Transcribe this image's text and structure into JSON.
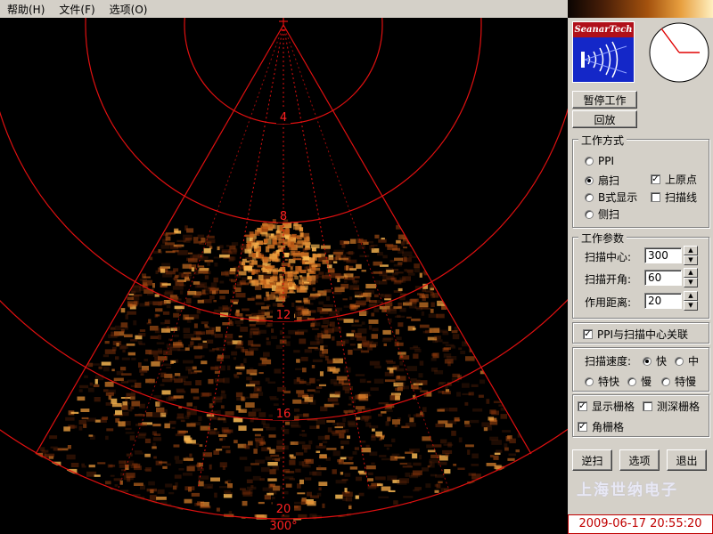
{
  "menu": {
    "items": [
      "帮助(H)",
      "文件(F)",
      "选项(O)"
    ]
  },
  "sonar": {
    "range_labels": [
      "4",
      "8",
      "12",
      "16",
      "20"
    ],
    "bearing_label": "300°",
    "grid_color": "#e01010",
    "echo_color": "#e8901e"
  },
  "logo": {
    "text": "SeanarTech"
  },
  "buttons": {
    "pause": "暂停工作",
    "playback": "回放",
    "reverse_scan": "逆扫",
    "options": "选项",
    "exit": "退出"
  },
  "work_mode": {
    "title": "工作方式",
    "modes": [
      {
        "label": "PPI",
        "selected": false
      },
      {
        "label": "扇扫",
        "selected": true
      },
      {
        "label": "B式显示",
        "selected": false
      },
      {
        "label": "侧扫",
        "selected": false
      }
    ],
    "upper_origin": {
      "label": "上原点",
      "checked": true
    },
    "scan_line": {
      "label": "扫描线",
      "checked": false
    }
  },
  "params": {
    "title": "工作参数",
    "fields": [
      {
        "label": "扫描中心:",
        "value": "300"
      },
      {
        "label": "扫描开角:",
        "value": "60"
      },
      {
        "label": "作用距离:",
        "value": "20"
      }
    ]
  },
  "link": {
    "label": "PPI与扫描中心关联",
    "checked": true
  },
  "speed": {
    "label": "扫描速度:",
    "options": [
      {
        "label": "快",
        "selected": true
      },
      {
        "label": "中",
        "selected": false
      },
      {
        "label": "特快",
        "selected": false
      },
      {
        "label": "慢",
        "selected": false
      },
      {
        "label": "特慢",
        "selected": false
      }
    ]
  },
  "grid": {
    "show_grid": {
      "label": "显示栅格",
      "checked": true
    },
    "depth_grid": {
      "label": "测深栅格",
      "checked": false
    },
    "angle_grid": {
      "label": "角栅格",
      "checked": true
    }
  },
  "watermark": "上海世纳电子",
  "datetime": "2009-06-17 20:55:20"
}
